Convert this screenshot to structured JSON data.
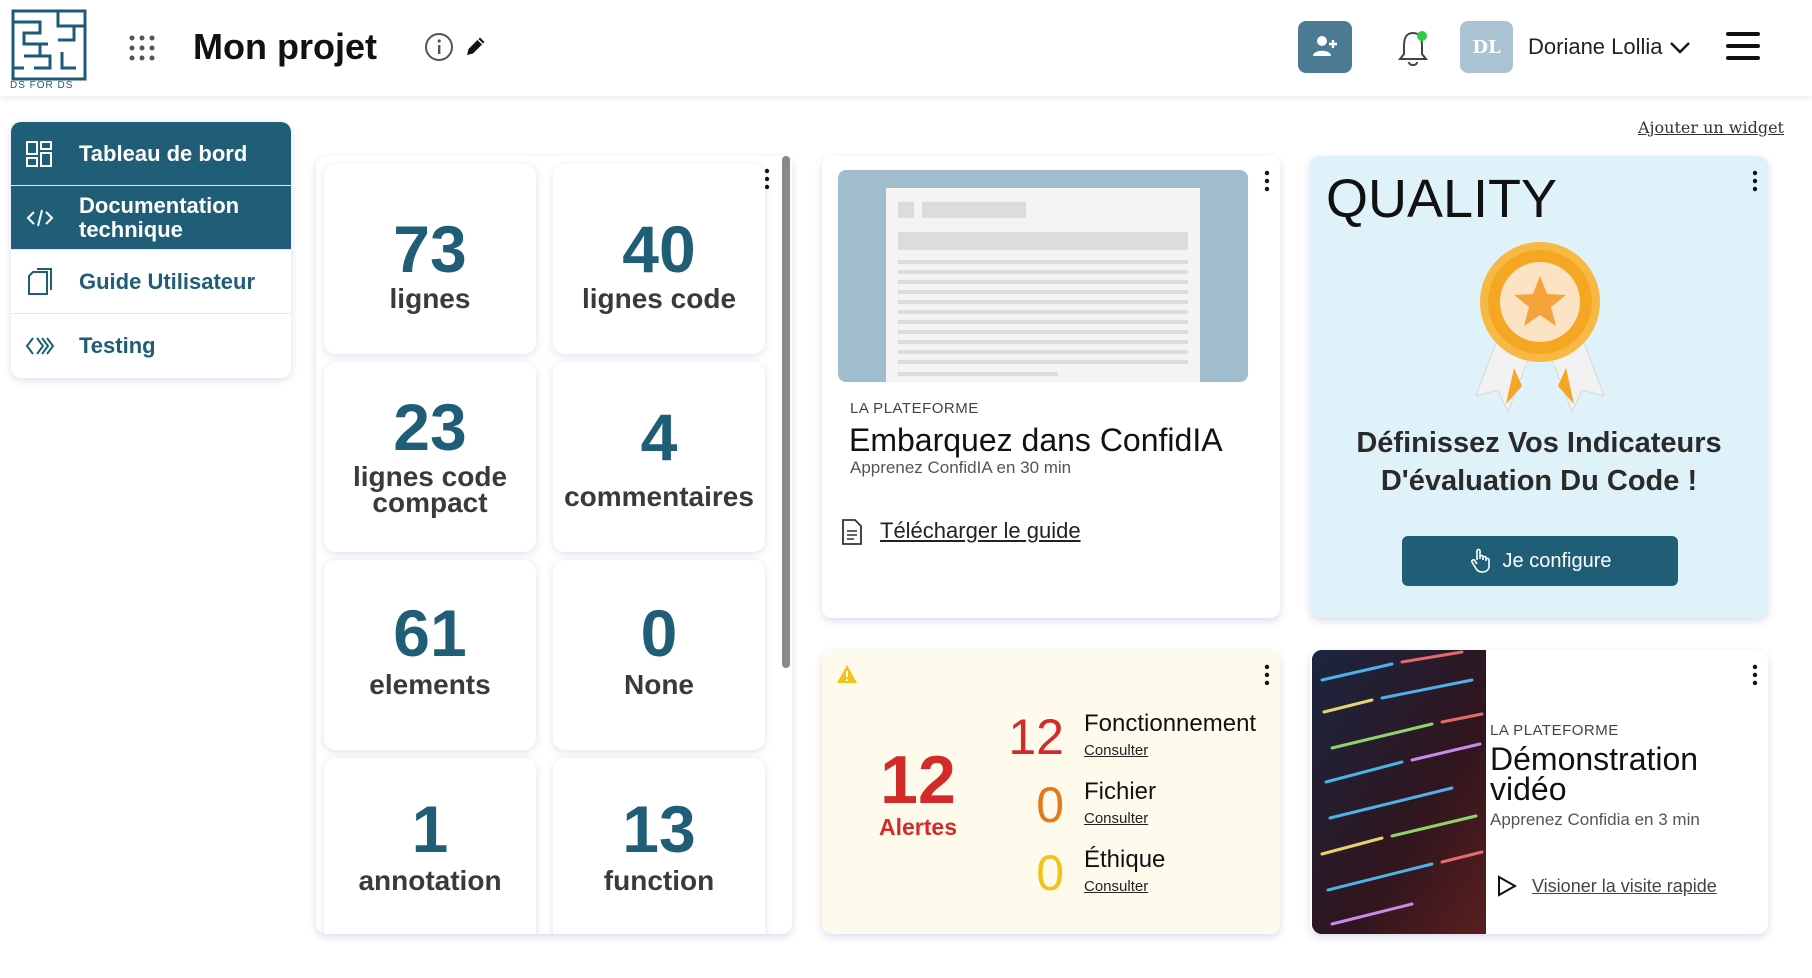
{
  "header": {
    "logo_text": "DS FOR DS",
    "project_title": "Mon projet",
    "user_initials": "DL",
    "user_name": "Doriane Lollia"
  },
  "sidebar": {
    "items": [
      {
        "label": "Tableau de bord",
        "icon": "dashboard-icon",
        "active": true
      },
      {
        "label": "Documentation technique",
        "icon": "code-icon",
        "active": true
      },
      {
        "label": "Guide Utilisateur",
        "icon": "document-icon",
        "active": false
      },
      {
        "label": "Testing",
        "icon": "testing-icon",
        "active": false
      }
    ]
  },
  "add_widget": "Ajouter un widget",
  "stats": [
    {
      "value": "73",
      "label": "lignes"
    },
    {
      "value": "40",
      "label": "lignes code"
    },
    {
      "value": "23",
      "label": "lignes code compact"
    },
    {
      "value": "4",
      "label": "commentaires"
    },
    {
      "value": "61",
      "label": "elements"
    },
    {
      "value": "0",
      "label": "None"
    },
    {
      "value": "1",
      "label": "annotation"
    },
    {
      "value": "13",
      "label": "function"
    }
  ],
  "guide": {
    "eyebrow": "LA PLATEFORME",
    "title": "Embarquez dans ConfidIA",
    "subtitle": "Apprenez ConfidIA en 30 min",
    "link": "Télécharger le guide"
  },
  "quality": {
    "title": "QUALITY",
    "text_line1": "Définissez Vos Indicateurs",
    "text_line2": "D'évaluation Du Code !",
    "button": "Je configure"
  },
  "alerts": {
    "total": "12",
    "total_label": "Alertes",
    "rows": [
      {
        "count": "12",
        "name": "Fonctionnement",
        "link": "Consulter",
        "color": "#d32a2a"
      },
      {
        "count": "0",
        "name": "Fichier",
        "link": "Consulter",
        "color": "#e07a1a"
      },
      {
        "count": "0",
        "name": "Éthique",
        "link": "Consulter",
        "color": "#f2c21d"
      }
    ]
  },
  "video": {
    "eyebrow": "LA PLATEFORME",
    "title_line1": "Démonstration",
    "title_line2": "vidéo",
    "subtitle": "Apprenez Confidia en 3 min",
    "link": "Visioner la visite rapide"
  },
  "colors": {
    "primary": "#1f5e76",
    "alert_red": "#d32a2a",
    "alert_orange": "#e07a1a",
    "alert_yellow": "#f2c21d",
    "quality_bg": "#dff2fa",
    "alert_bg": "#fffbec"
  }
}
